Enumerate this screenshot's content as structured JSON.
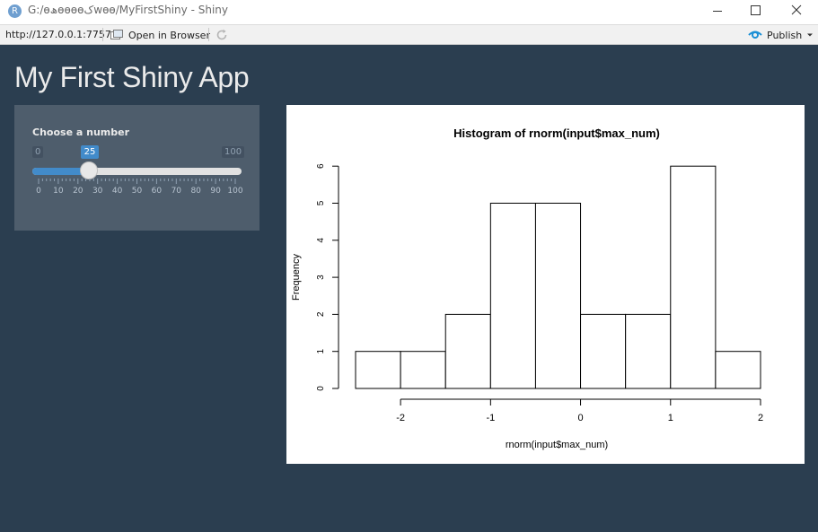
{
  "window": {
    "title": "G:/ɵھɵɵɵɵکwɵɵ/MyFirstShiny - Shiny",
    "app_icon": "R",
    "buttons": [
      "minimize-icon",
      "maximize-icon",
      "close-icon"
    ]
  },
  "toolbar": {
    "url": "http://127.0.0.1:7757",
    "open_browser_label": "Open in Browser",
    "publish_label": "Publish",
    "accent": "#1a8fd6"
  },
  "app": {
    "title": "My First Shiny App",
    "background": "#2b3e50"
  },
  "slider": {
    "label": "Choose a number",
    "min": "0",
    "max": "100",
    "value": "25",
    "fraction": 0.25,
    "tick_labels": [
      "0",
      "10",
      "20",
      "30",
      "40",
      "50",
      "60",
      "70",
      "80",
      "90",
      "100"
    ],
    "accent": "#428bca"
  },
  "chart_data": {
    "type": "bar",
    "title": "Histogram of rnorm(input$max_num)",
    "xlabel": "rnorm(input$max_num)",
    "ylabel": "Frequency",
    "bins": [
      {
        "from": -2.5,
        "to": -2.0,
        "count": 1
      },
      {
        "from": -2.0,
        "to": -1.5,
        "count": 1
      },
      {
        "from": -1.5,
        "to": -1.0,
        "count": 2
      },
      {
        "from": -1.0,
        "to": -0.5,
        "count": 5
      },
      {
        "from": -0.5,
        "to": 0.0,
        "count": 5
      },
      {
        "from": 0.0,
        "to": 0.5,
        "count": 2
      },
      {
        "from": 0.5,
        "to": 1.0,
        "count": 2
      },
      {
        "from": 1.0,
        "to": 1.5,
        "count": 6
      },
      {
        "from": 1.5,
        "to": 2.0,
        "count": 1
      }
    ],
    "xticks": [
      "-2",
      "-1",
      "0",
      "1",
      "2"
    ],
    "yticks": [
      "0",
      "1",
      "2",
      "3",
      "4",
      "5",
      "6"
    ],
    "xlim": [
      -2.5,
      2.0
    ],
    "ylim": [
      0,
      6
    ],
    "grid": false
  }
}
